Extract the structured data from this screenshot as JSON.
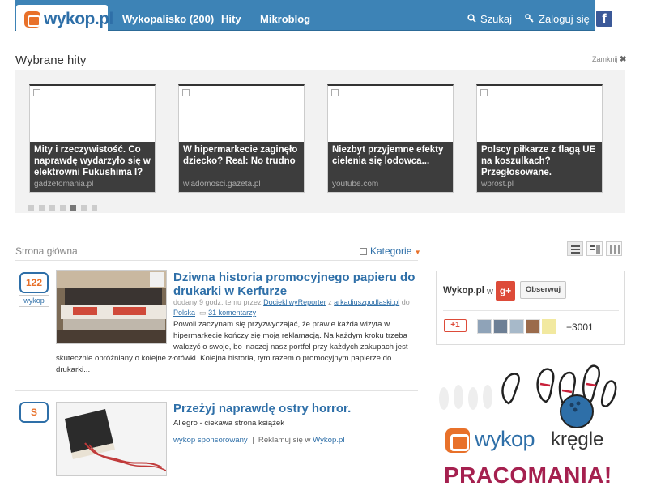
{
  "header": {
    "logo": "wykop.pl",
    "nav": [
      "Wykopalisko (200)",
      "Hity",
      "Mikroblog"
    ],
    "search": "Szukaj",
    "login": "Zaloguj się",
    "facebook_glyph": "f"
  },
  "hits": {
    "title": "Wybrane hity",
    "close": "Zamknij",
    "close_glyph": "✖",
    "cards": [
      {
        "title": "Mity i rzeczywistość. Co naprawdę wydarzyło się w elektrowni Fukushima I?",
        "source": "gadzetomania.pl"
      },
      {
        "title": "W hipermarkecie zaginęło dziecko? Real: No trudno",
        "source": "wiadomosci.gazeta.pl"
      },
      {
        "title": "Niezbyt przyjemne efekty cielenia się lodowca...",
        "source": "youtube.com"
      },
      {
        "title": "Polscy piłkarze z flagą UE na koszulkach? Przegłosowane.",
        "source": "wprost.pl"
      }
    ],
    "dots_total": 7,
    "dots_active": 5
  },
  "main": {
    "section_title": "Strona główna",
    "kategorie": "Kategorie",
    "caret": "▼",
    "articles": [
      {
        "votes": "122",
        "vote_button": "wykop",
        "title_line1": "Dziwna historia promocyjnego papieru do",
        "title_line2": "drukarki w Kerfurze",
        "meta_prefix": "dodany 9 godz. temu przez",
        "meta_user": "DociekliwyReporter",
        "meta_z": "z",
        "meta_domain": "arkadiuszpodlaski.pl",
        "meta_do": "do",
        "meta_tag": "Polska",
        "meta_comments": "31 komentarzy",
        "desc_lines": [
          "Powoli zaczynam się przyzwyczajać, że prawie każda wizyta w",
          "hipermarkecie kończy się moją reklamacją. Na każdym kroku trzeba",
          "walczyć o swoje, bo inaczej nasz portfel przy każdych zakupach jest"
        ],
        "desc_lines_wide": [
          "skutecznie opróżniany o kolejne złotówki. Kolejna historia, tym razem o promocyjnym papierze do",
          "drukarki..."
        ]
      },
      {
        "votes": "S",
        "title": "Przeżyj naprawdę ostry horror.",
        "subtitle": "Allegro - ciekawa strona książek",
        "sponsored": "wykop sponsorowany",
        "separator": "|",
        "advertise": "Reklamuj się w",
        "advertise_link": "Wykop.pl"
      }
    ]
  },
  "sidebar": {
    "gplus": {
      "name": "Wykop.pl",
      "w": "w",
      "logo": "g+",
      "follow": "Obserwuj",
      "plus_one": "+1",
      "count": "+3001"
    },
    "ad": {
      "logo": "wykop",
      "suffix": "kręgle",
      "banner": "PRACOMANIA!"
    }
  },
  "colors": {
    "brand_blue": "#3d83b6",
    "link_blue": "#2e6fa8",
    "orange": "#e8712a",
    "gplus_red": "#dd4b39"
  }
}
